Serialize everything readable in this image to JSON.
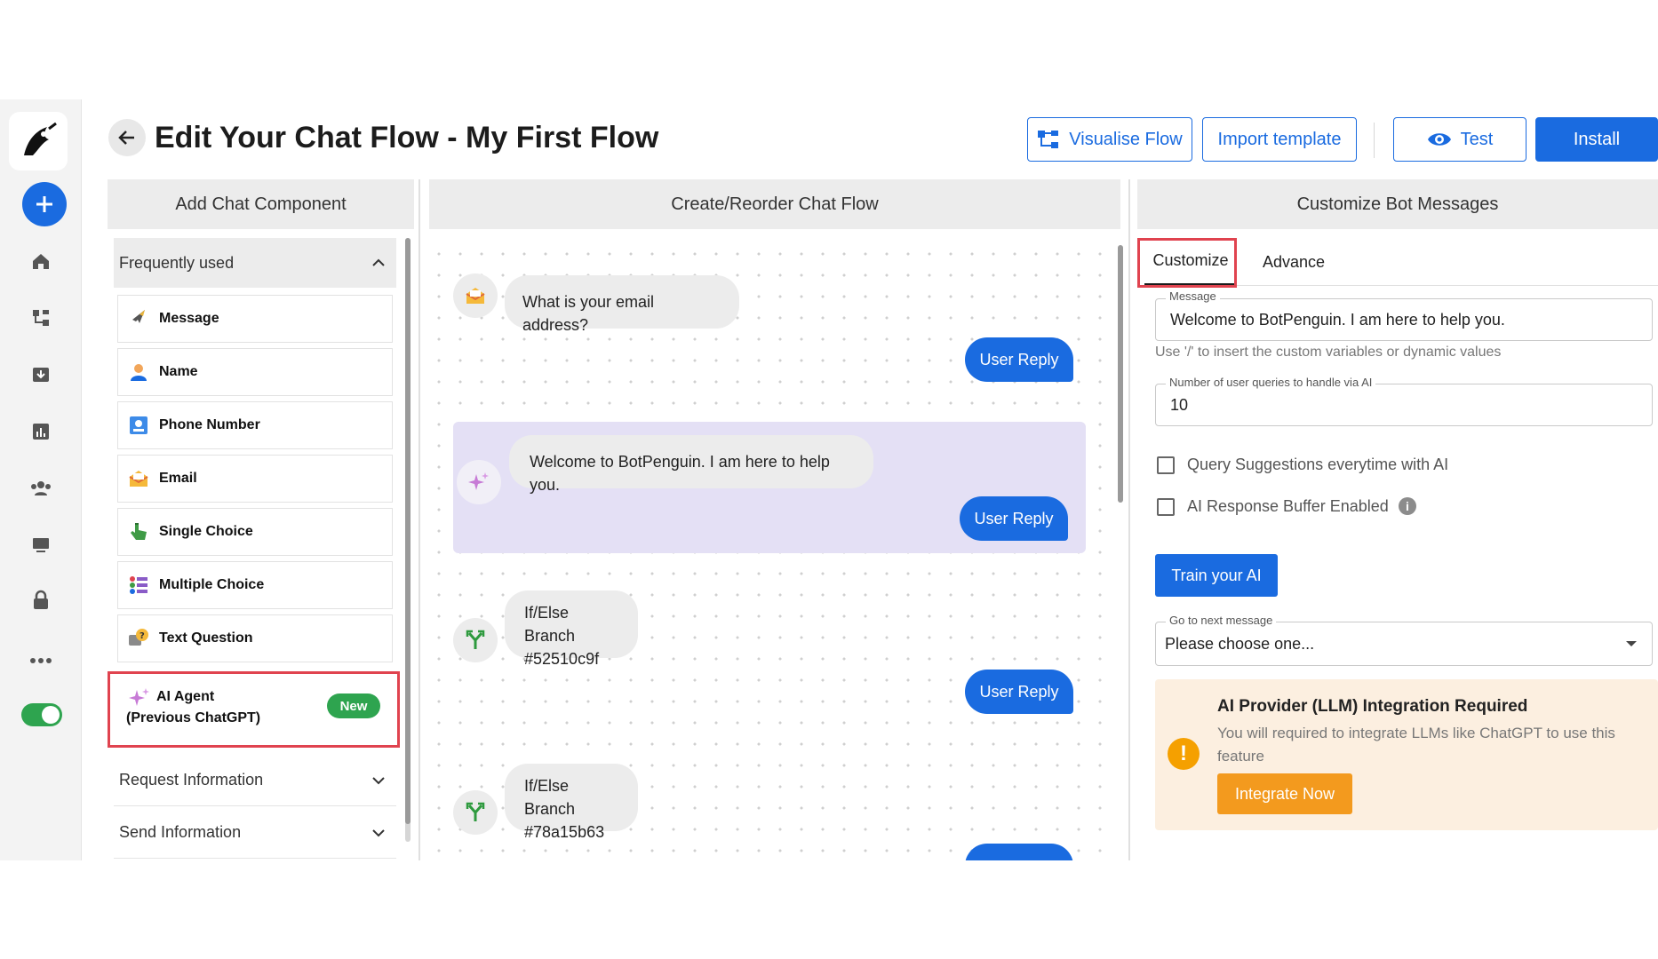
{
  "header": {
    "title": "Edit Your Chat Flow - My First Flow",
    "visualise_label": "Visualise Flow",
    "import_label": "Import template",
    "test_label": "Test",
    "install_label": "Install"
  },
  "panels": {
    "left_title": "Add Chat Component",
    "middle_title": "Create/Reorder Chat Flow",
    "right_title": "Customize Bot Messages"
  },
  "components": {
    "section": "Frequently used",
    "items": [
      {
        "label": "Message",
        "icon": "rocket-icon"
      },
      {
        "label": "Name",
        "icon": "user-icon"
      },
      {
        "label": "Phone Number",
        "icon": "phone-card-icon"
      },
      {
        "label": "Email",
        "icon": "envelope-icon"
      },
      {
        "label": "Single Choice",
        "icon": "hand-pointer-icon"
      },
      {
        "label": "Multiple Choice",
        "icon": "list-choice-icon"
      },
      {
        "label": "Text Question",
        "icon": "question-bubble-icon"
      }
    ],
    "ai_agent": {
      "label": "AI Agent (Previous ChatGPT)",
      "badge": "New"
    },
    "sections_collapsed": [
      "Request Information",
      "Send Information"
    ]
  },
  "flow": {
    "email_question": "What is your email address?",
    "welcome_message": "Welcome to BotPenguin. I am here to help you.",
    "branch_1": [
      "If/Else Branch",
      "#52510c9f"
    ],
    "branch_2": [
      "If/Else Branch",
      "#78a15b63"
    ],
    "user_reply": "User Reply"
  },
  "customize": {
    "tabs": [
      "Customize",
      "Advance"
    ],
    "message_label": "Message",
    "message_value": "Welcome to BotPenguin. I am here to help you.",
    "helper": "Use '/' to insert the custom variables or dynamic values",
    "queries_label": "Number of user queries to handle via AI",
    "queries_value": "10",
    "checkbox_1": "Query Suggestions everytime with AI",
    "checkbox_2": "AI Response Buffer Enabled",
    "train_label": "Train your AI",
    "next_label": "Go to next message",
    "next_value": "Please choose one...",
    "alert_title": "AI Provider (LLM) Integration Required",
    "alert_text": "You will required to integrate LLMs like ChatGPT to use this feature",
    "integrate_label": "Integrate Now"
  },
  "colors": {
    "primary": "#1a6be0",
    "success": "#2ea44f",
    "highlight": "#e0434f",
    "warning": "#f39a1e"
  }
}
